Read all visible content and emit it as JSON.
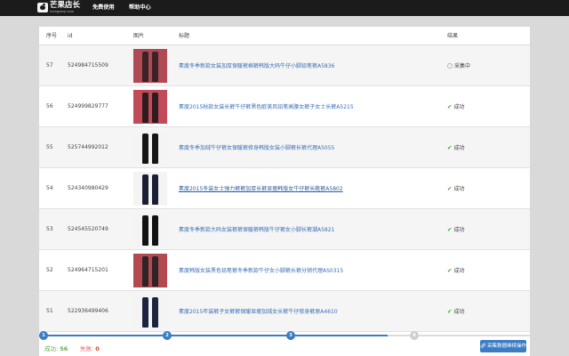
{
  "topbar": {
    "logo_text": "芒果店长",
    "logo_sub": "mangoerp.com",
    "nav": [
      {
        "label": "免费使用"
      },
      {
        "label": "帮助中心"
      }
    ]
  },
  "table": {
    "headers": {
      "seq": "序号",
      "id": "id",
      "image": "图片",
      "title": "标题",
      "result": "结果"
    },
    "rows": [
      {
        "seq": "57",
        "id": "524984715509",
        "title": "素度冬季新款女装加厚保暖裤棉裤韩版大码牛仔小脚铅笔裤A5836",
        "status": "采集中",
        "status_type": "loading",
        "image_colors": [
          "#3a2226",
          "#b04a55"
        ]
      },
      {
        "seq": "56",
        "id": "524999829777",
        "title": "素度2015秋款女装长裤牛仔裤黑色欧美风铅笔高腰女裤子女士长裤A5215",
        "status": "成功",
        "status_type": "success",
        "image_colors": [
          "#2e1b1e",
          "#c24b5a"
        ]
      },
      {
        "seq": "55",
        "id": "525744992012",
        "title": "素度冬季加绒牛仔裤女保暖裤修身韩版女装小脚裤长裤代理A5055",
        "status": "成功",
        "status_type": "success",
        "image_colors": [
          "#161616",
          "#f4f4f4"
        ]
      },
      {
        "seq": "54",
        "id": "524340980429",
        "title": "素度2015冬装女士弹力裤裤加厚长裤显瘦韩版女牛仔裤长靴裤A5802",
        "status": "成功",
        "status_type": "success",
        "image_colors": [
          "#1a1f33",
          "#f4f4f4"
        ],
        "hover": true
      },
      {
        "seq": "53",
        "id": "524545520749",
        "title": "素度冬季新款大码女装裤裤保暖裤韩版牛仔裤女小脚长裤潮A5821",
        "status": "成功",
        "status_type": "success",
        "image_colors": [
          "#121212",
          "#f4f4f4"
        ]
      },
      {
        "seq": "52",
        "id": "524964715201",
        "title": "素度韩版女装黑色铅笔裤冬季新款牛仔女小脚裤长裤分销代理AS0315",
        "status": "成功",
        "status_type": "success",
        "image_colors": [
          "#2d2426",
          "#b34a52"
        ]
      },
      {
        "seq": "51",
        "id": "522936499406",
        "title": "素度2015年装裤子女裤裤保暖显瘦加绒女长裤牛仔修身裤原A4610",
        "status": "成功",
        "status_type": "success",
        "image_colors": [
          "#1c2540",
          "#f4f4f4"
        ]
      }
    ]
  },
  "footer": {
    "progress_steps": [
      {
        "label": "1",
        "done": true
      },
      {
        "label": "2",
        "done": true
      },
      {
        "label": "3",
        "done": true
      },
      {
        "label": "4",
        "done": false
      }
    ],
    "progress_fraction": 0.71,
    "success_label": "成功:",
    "success_count": "56",
    "fail_label": "失败:",
    "fail_count": "0",
    "action_button": "采集数据继续操作",
    "action_icon": "link-icon"
  },
  "colors": {
    "accent": "#3b7dc4",
    "success": "#3aa536",
    "link": "#3a6fb5",
    "topbar": "#1b1b1b"
  }
}
